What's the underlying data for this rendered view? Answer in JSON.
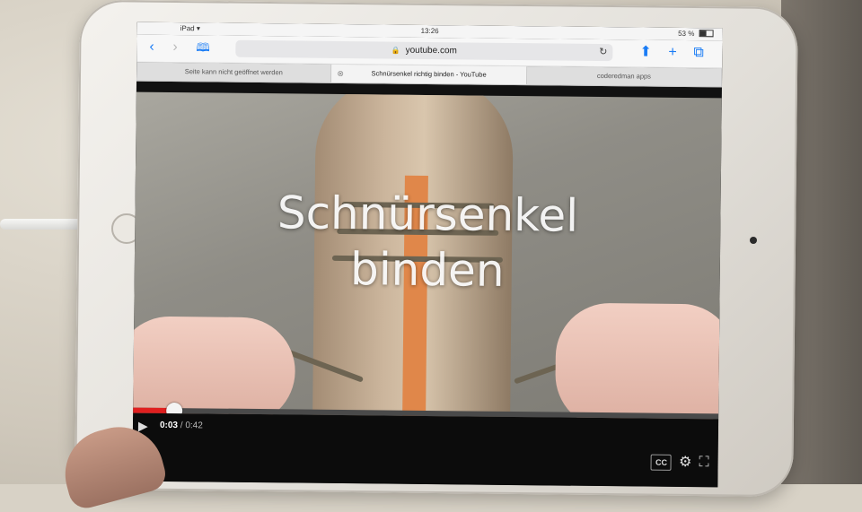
{
  "status_bar": {
    "device": "iPad",
    "wifi_icon": "wifi-icon",
    "time": "13:26",
    "battery": "53 %"
  },
  "toolbar": {
    "back_icon": "chevron-left-icon",
    "forward_icon": "chevron-right-icon",
    "bookmarks_icon": "book-icon",
    "url": "youtube.com",
    "lock_icon": "lock-icon",
    "reload_icon": "reload-icon",
    "share_icon": "share-icon",
    "new_tab_icon": "plus-icon",
    "tabs_icon": "tabs-icon"
  },
  "tabs": [
    {
      "label": "Seite kann nicht geöffnet werden",
      "active": false
    },
    {
      "label": "Schnürsenkel richtig binden - YouTube",
      "active": true
    },
    {
      "label": "coderedman apps",
      "active": false
    }
  ],
  "video": {
    "title_line1": "Schnürsenkel",
    "title_line2": "binden",
    "current_time": "0:03",
    "duration": "0:42",
    "progress": 0.07
  },
  "controls": {
    "cc_label": "CC",
    "settings_icon": "gear-icon",
    "fullscreen_icon": "fullscreen-icon",
    "play_icon": "play-icon"
  },
  "colors": {
    "progress_red": "#e01f1f",
    "safari_blue": "#1a7cf5"
  }
}
